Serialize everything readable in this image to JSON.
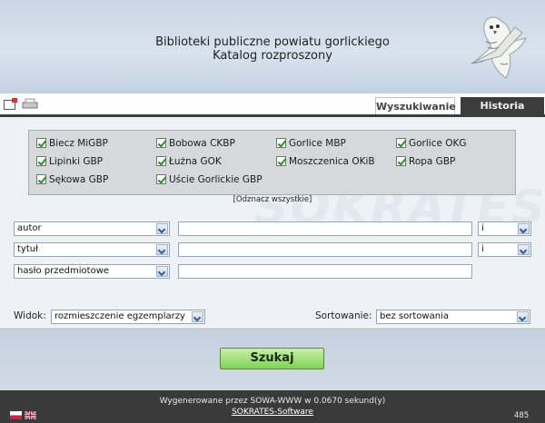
{
  "header": {
    "title_line1": "Biblioteki publiczne powiatu gorlickiego",
    "title_line2": "Katalog rozproszony",
    "logo_icon": "owl-icon"
  },
  "toolbar": {
    "icons": [
      "new-window-icon",
      "print-icon"
    ]
  },
  "tabs": [
    {
      "label": "Wyszukiwanie",
      "active": true
    },
    {
      "label": "Historia",
      "active": false
    }
  ],
  "libraries": [
    {
      "label": "Biecz MiGBP",
      "checked": true
    },
    {
      "label": "Bobowa CKBP",
      "checked": true
    },
    {
      "label": "Gorlice MBP",
      "checked": true
    },
    {
      "label": "Gorlice OKG",
      "checked": true
    },
    {
      "label": "Lipinki GBP",
      "checked": true
    },
    {
      "label": "Łużna GOK",
      "checked": true
    },
    {
      "label": "Moszczenica OKiB",
      "checked": true
    },
    {
      "label": "Ropa GBP",
      "checked": true
    },
    {
      "label": "Sękowa GBP",
      "checked": true
    },
    {
      "label": "Uście Gorlickie GBP",
      "checked": true
    }
  ],
  "unmark_all": "[Odznacz wszystkie]",
  "search_rows": [
    {
      "field": "autor",
      "value": "",
      "operator": "i"
    },
    {
      "field": "tytuł",
      "value": "",
      "operator": "i"
    },
    {
      "field": "hasło przedmiotowe",
      "value": ""
    }
  ],
  "options": {
    "view_label": "Widok:",
    "view_value": "rozmieszczenie egzemplarzy",
    "sort_label": "Sortowanie:",
    "sort_value": "bez sortowania"
  },
  "search_button": "Szukaj",
  "footer": {
    "generated": "Wygenerowane przez SOWA-WWW w 0.0670 sekund(y)",
    "link": "SOKRATES-Software",
    "counter": "485",
    "flags": [
      "flag-pl-icon",
      "flag-uk-icon"
    ]
  },
  "colors": {
    "header_bg": "#d9e3ee",
    "panel_bg": "#eef2f6",
    "tab_dark": "#3d3d3d",
    "button_green": "#7fd357",
    "footer_bg": "#3a3a3a"
  }
}
